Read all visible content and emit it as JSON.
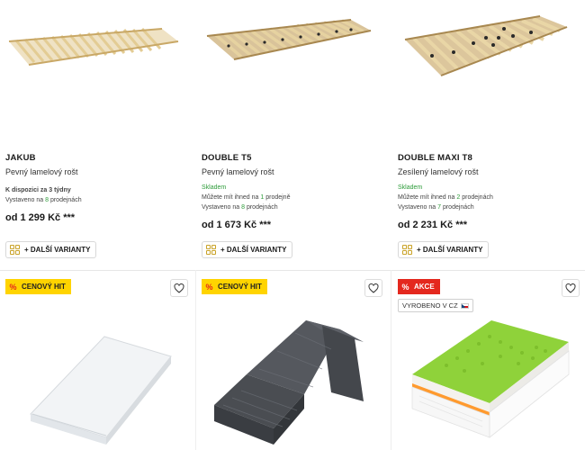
{
  "products_top": [
    {
      "name": "JAKUB",
      "subtitle": "Pevný lamelový rošt",
      "availability_line1": "K dispozici za 3 týdny",
      "availability_line2_prefix": "Vystaveno na ",
      "availability_line2_count": "8",
      "availability_line2_suffix": " prodejnách",
      "price": "od 1 299 Kč ***",
      "variants_label": "+ DALŠÍ VARIANTY"
    },
    {
      "name": "DOUBLE T5",
      "subtitle": "Pevný lamelový rošt",
      "stock": "Skladem",
      "availability_line1_prefix": "Můžete mít ihned na ",
      "availability_line1_count": "1",
      "availability_line1_suffix": " prodejně",
      "availability_line2_prefix": "Vystaveno na ",
      "availability_line2_count": "8",
      "availability_line2_suffix": " prodejnách",
      "price": "od 1 673 Kč ***",
      "variants_label": "+ DALŠÍ VARIANTY"
    },
    {
      "name": "DOUBLE MAXI T8",
      "subtitle": "Zesílený lamelový rošt",
      "stock": "Skladem",
      "availability_line1_prefix": "Můžete mít ihned na ",
      "availability_line1_count": "2",
      "availability_line1_suffix": " prodejnách",
      "availability_line2_prefix": "Vystaveno na ",
      "availability_line2_count": "7",
      "availability_line2_suffix": " prodejnách",
      "price": "od 2 231 Kč ***",
      "variants_label": "+ DALŠÍ VARIANTY"
    }
  ],
  "products_bottom": [
    {
      "badge": "CENOVÝ HIT",
      "badge_type": "hit",
      "badge_symbol": "%"
    },
    {
      "badge": "CENOVÝ HIT",
      "badge_type": "hit",
      "badge_symbol": "%"
    },
    {
      "badge": "AKCE",
      "badge_type": "akce",
      "badge_symbol": "%",
      "made_in": "VYROBENO V CZ"
    }
  ],
  "colors": {
    "hit_badge": "#ffd400",
    "akce_badge": "#e4281e",
    "stock_green": "#2e9c3a",
    "mattress_green": "#8fd23a"
  },
  "icons": [
    "heart-icon",
    "variants-icon",
    "percent-icon",
    "czech-flag-icon"
  ]
}
